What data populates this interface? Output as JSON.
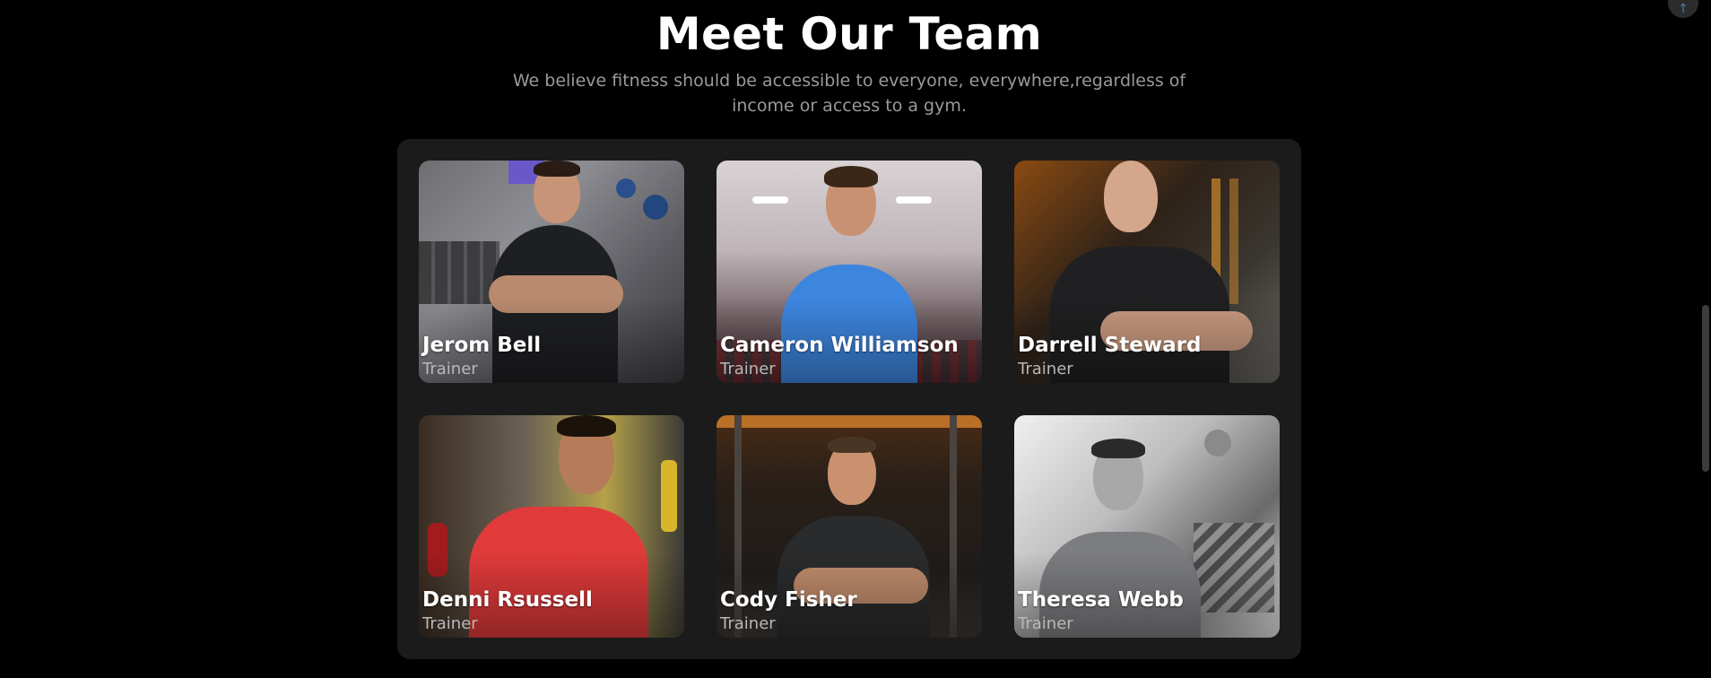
{
  "section": {
    "title": "Meet Our Team",
    "subtitle": "We believe fitness should be accessible to everyone, everywhere,regardless of income or access to a gym."
  },
  "team": [
    {
      "name": "Jerom Bell",
      "role": "Trainer",
      "photo": "trainer-in-black-shirt-gym-photo"
    },
    {
      "name": "Cameron Williamson",
      "role": "Trainer",
      "photo": "trainer-in-blue-shirt-gym-photo"
    },
    {
      "name": "Darrell Steward",
      "role": "Trainer",
      "photo": "bald-trainer-in-black-shirt-photo"
    },
    {
      "name": "Denni Rsussell",
      "role": "Trainer",
      "photo": "trainer-in-red-shirt-photo"
    },
    {
      "name": "Cody Fisher",
      "role": "Trainer",
      "photo": "trainer-with-glasses-gym-photo"
    },
    {
      "name": "Theresa Webb",
      "role": "Trainer",
      "photo": "trainer-grayscale-fitness-studio-photo"
    }
  ],
  "colors": {
    "background": "#000000",
    "panel": "#1b1b1b",
    "title": "#ffffff",
    "subtitle": "#9a9a9a",
    "role": "#b8b8b8"
  }
}
